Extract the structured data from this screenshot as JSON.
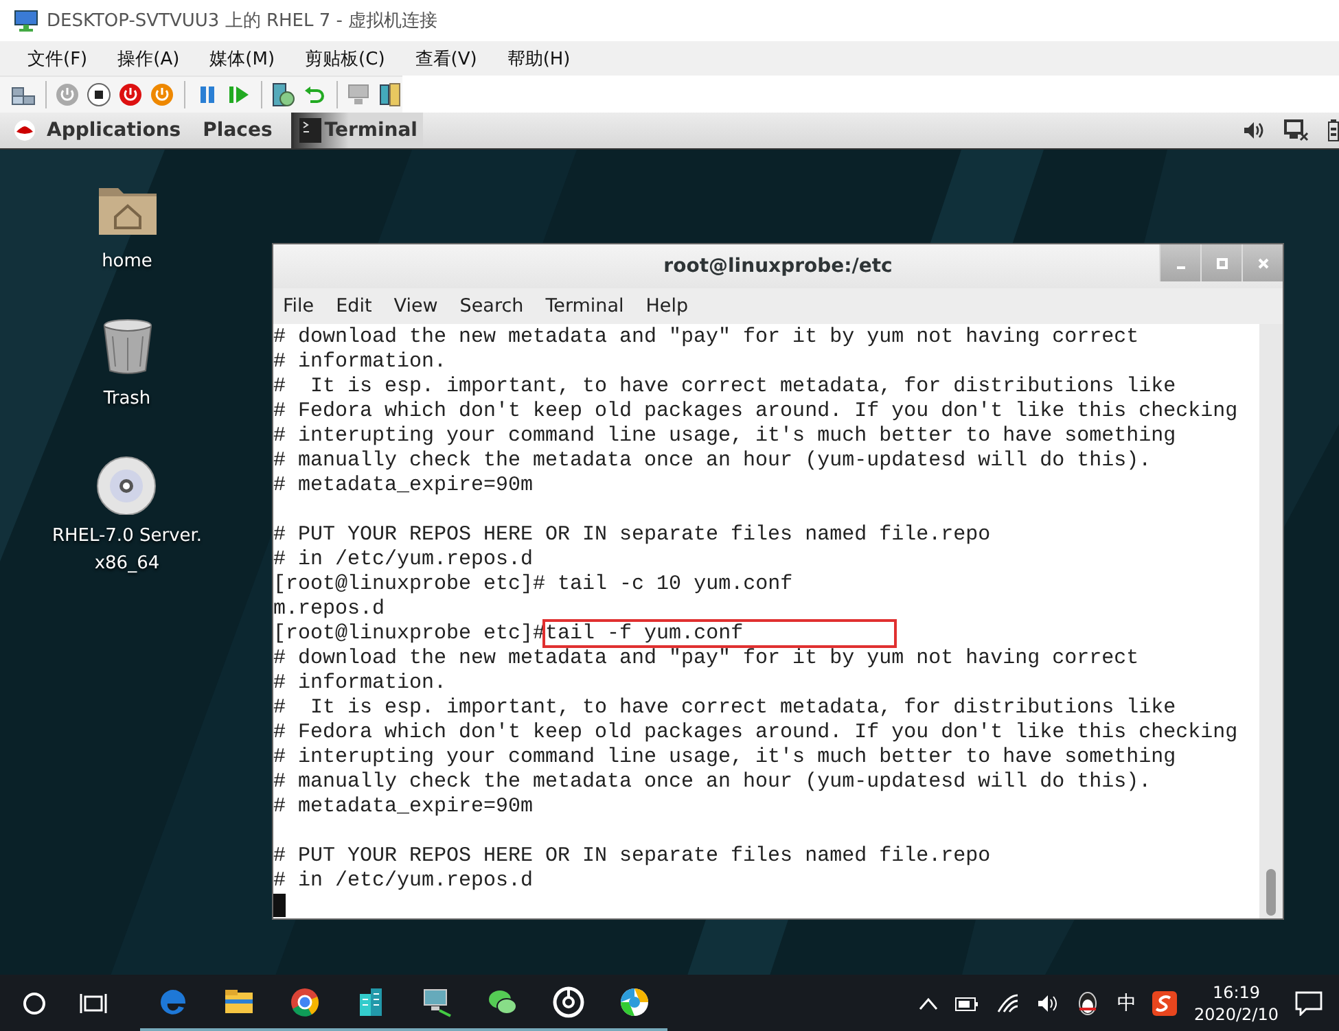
{
  "window": {
    "title": "DESKTOP-SVTVUU3 上的 RHEL 7 - 虚拟机连接"
  },
  "menu": [
    "文件(F)",
    "操作(A)",
    "媒体(M)",
    "剪贴板(C)",
    "查看(V)",
    "帮助(H)"
  ],
  "gnome_bar": {
    "applications": "Applications",
    "places": "Places",
    "active_app": "Terminal"
  },
  "desktop_icons": [
    {
      "kind": "home",
      "label": "home"
    },
    {
      "kind": "trash",
      "label": "Trash"
    },
    {
      "kind": "dvd",
      "label": "RHEL-7.0 Server.\nx86_64"
    }
  ],
  "terminal": {
    "title": "root@linuxprobe:/etc",
    "menu": [
      "File",
      "Edit",
      "View",
      "Search",
      "Terminal",
      "Help"
    ],
    "lines": [
      {
        "kind": "output",
        "text": "# download the new metadata and \"pay\" for it by yum not having correct"
      },
      {
        "kind": "output",
        "text": "# information."
      },
      {
        "kind": "output",
        "text": "#  It is esp. important, to have correct metadata, for distributions like"
      },
      {
        "kind": "output",
        "text": "# Fedora which don't keep old packages around. If you don't like this checking"
      },
      {
        "kind": "output",
        "text": "# interupting your command line usage, it's much better to have something"
      },
      {
        "kind": "output",
        "text": "# manually check the metadata once an hour (yum-updatesd will do this)."
      },
      {
        "kind": "output",
        "text": "# metadata_expire=90m"
      },
      {
        "kind": "blank"
      },
      {
        "kind": "output",
        "text": "# PUT YOUR REPOS HERE OR IN separate files named file.repo"
      },
      {
        "kind": "output",
        "text": "# in /etc/yum.repos.d"
      },
      {
        "kind": "prompt",
        "prompt": "[root@linuxprobe etc]#",
        "command": " tail -c 10 yum.conf",
        "highlighted": false
      },
      {
        "kind": "output",
        "text": "m.repos.d"
      },
      {
        "kind": "prompt",
        "prompt": "[root@linuxprobe etc]#",
        "command": "tail -f yum.conf",
        "highlighted": true
      },
      {
        "kind": "output",
        "text": "# download the new metadata and \"pay\" for it by yum not having correct"
      },
      {
        "kind": "output",
        "text": "# information."
      },
      {
        "kind": "output",
        "text": "#  It is esp. important, to have correct metadata, for distributions like"
      },
      {
        "kind": "output",
        "text": "# Fedora which don't keep old packages around. If you don't like this checking"
      },
      {
        "kind": "output",
        "text": "# interupting your command line usage, it's much better to have something"
      },
      {
        "kind": "output",
        "text": "# manually check the metadata once an hour (yum-updatesd will do this)."
      },
      {
        "kind": "output",
        "text": "# metadata_expire=90m"
      },
      {
        "kind": "blank"
      },
      {
        "kind": "output",
        "text": "# PUT YOUR REPOS HERE OR IN separate files named file.repo"
      },
      {
        "kind": "output",
        "text": "# in /etc/yum.repos.d"
      },
      {
        "kind": "cursor"
      }
    ]
  },
  "taskbar": {
    "apps": [
      {
        "kind": "edge"
      },
      {
        "kind": "folder"
      },
      {
        "kind": "chrome"
      },
      {
        "kind": "building"
      },
      {
        "kind": "computer"
      },
      {
        "kind": "chat"
      },
      {
        "kind": "music"
      },
      {
        "kind": "qq"
      }
    ],
    "time": "16:19",
    "date": "2020/2/10",
    "ime": "中"
  }
}
